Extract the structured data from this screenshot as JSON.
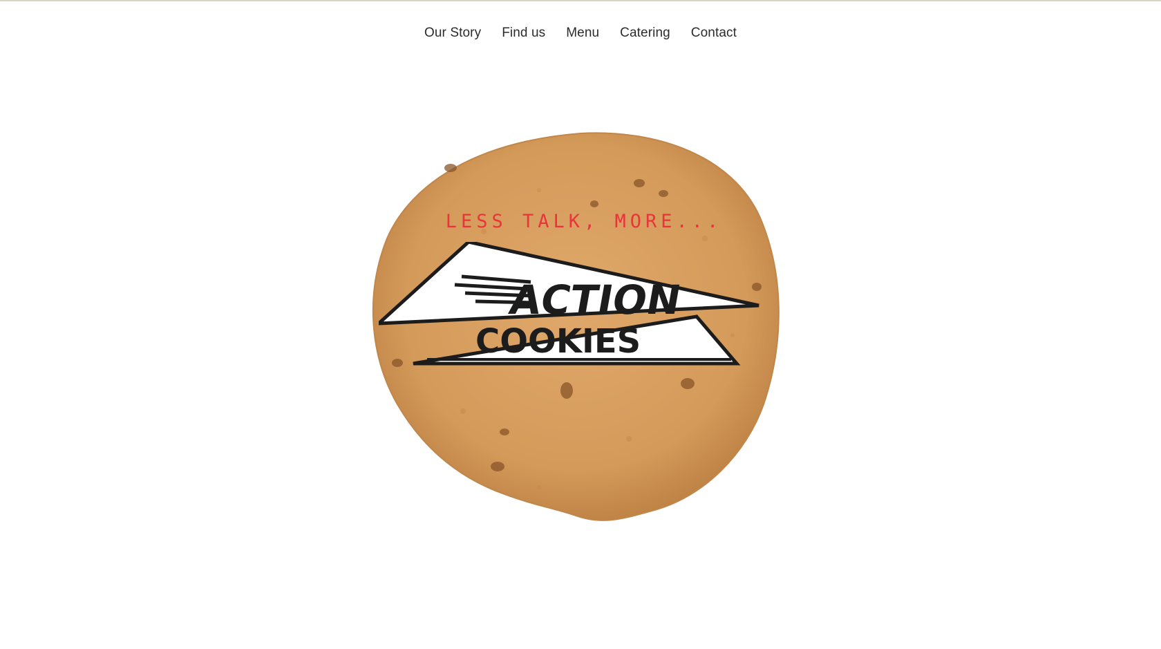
{
  "nav": {
    "items": [
      {
        "label": "Our Story"
      },
      {
        "label": "Find us"
      },
      {
        "label": "Menu"
      },
      {
        "label": "Catering"
      },
      {
        "label": "Contact"
      }
    ]
  },
  "hero": {
    "tagline": "LESS TALK, MORE...",
    "logo_line_1": "ACTION",
    "logo_line_2": "COOKIES"
  },
  "colors": {
    "tagline": "#e8343a",
    "nav_text": "#2b2b2b",
    "cookie": "#d9a062"
  }
}
